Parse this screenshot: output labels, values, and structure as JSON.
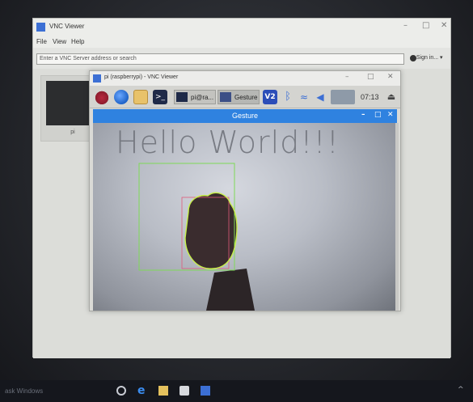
{
  "outer_window": {
    "title": "VNC Viewer",
    "menu": [
      "File",
      "View",
      "Help"
    ],
    "address_placeholder": "Enter a VNC Server address or search",
    "sign_in_label": "Sign in...",
    "thumbnail_label": "pi"
  },
  "inner_window": {
    "title": "pi (raspberrypi) - VNC Viewer",
    "taskbar": {
      "terminal_task_label": "pi@ra...",
      "gesture_task_label": "Gesture",
      "clock": "07:13"
    }
  },
  "gesture_window": {
    "title": "Gesture",
    "overlay_text": "Hello World!!!"
  },
  "host_taskbar": {
    "search_text": "ask Windows"
  },
  "colors": {
    "gesture_titlebar": "#2f82e0",
    "detection_box": "#7ed957",
    "contour": "#c8f04a",
    "inner_box": "#e05a7a"
  }
}
